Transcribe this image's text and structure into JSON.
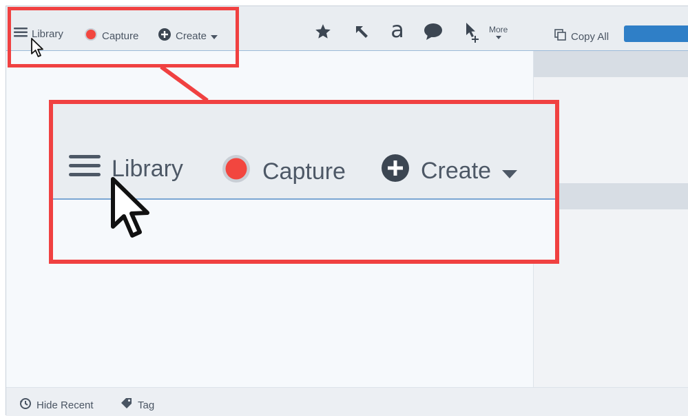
{
  "toolbar": {
    "library_label": "Library",
    "capture_label": "Capture",
    "create_label": "Create",
    "more_label": "More",
    "copy_all_label": "Copy All",
    "tools": [
      {
        "icon": "star-icon"
      },
      {
        "icon": "arrow-icon"
      },
      {
        "icon": "text-icon",
        "glyph": "a"
      },
      {
        "icon": "callout-icon"
      },
      {
        "icon": "stamp-cursor-icon"
      }
    ]
  },
  "zoom": {
    "library_label": "Library",
    "capture_label": "Capture",
    "create_label": "Create"
  },
  "status": {
    "hide_recent_label": "Hide Recent",
    "tag_label": "Tag"
  },
  "colors": {
    "highlight": "#f04141",
    "record": "#f2463f",
    "accent": "#2f7fc7"
  }
}
